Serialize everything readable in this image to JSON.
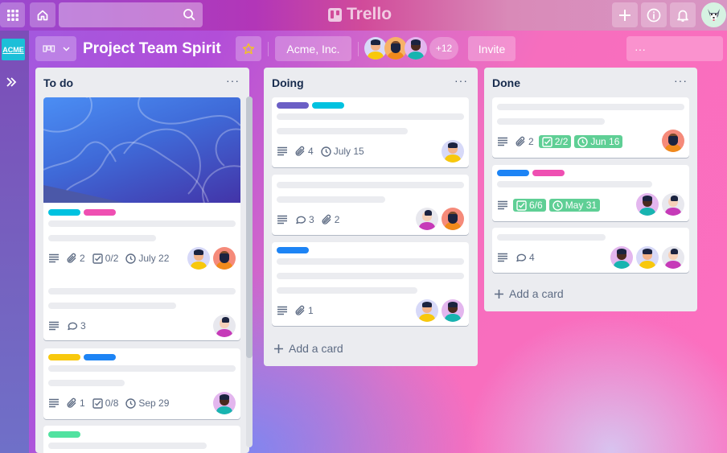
{
  "topbar": {
    "apps_icon": "grid-icon",
    "home_icon": "home-icon",
    "search_placeholder": "",
    "logo_text": "Trello",
    "create_icon": "plus-icon",
    "info_icon": "info-icon",
    "notifications_icon": "bell-icon",
    "profile_avatar": "husky-avatar"
  },
  "sidebar": {
    "workspace_logo": "ACME",
    "expand_icon": "double-chevron-right-icon"
  },
  "board_header": {
    "title": "Project Team Spirit",
    "starred": true,
    "workspace": "Acme, Inc.",
    "member_extra_count": "+12",
    "invite_label": "Invite",
    "more_label": "···"
  },
  "colors": {
    "green_badge": "#5fcf95",
    "cyan": "#00c2e0",
    "pink": "#ef4fb2",
    "purple": "#6b5fc5",
    "blue": "#1d84f5",
    "yellow": "#f8c80c",
    "green": "#51e2a0"
  },
  "lists": [
    {
      "title": "To do",
      "menu": "···",
      "cards": [
        {
          "cover": true,
          "labels": [
            "cyan",
            "pink"
          ],
          "attachments": "2",
          "checklist": "0/2",
          "due": "July 22",
          "members": [
            "yellow",
            "orange"
          ]
        },
        {
          "labels": [],
          "comments": "3",
          "members": [
            "magenta"
          ]
        },
        {
          "labels": [
            "yellow",
            "blue"
          ],
          "attachments": "1",
          "checklist": "0/8",
          "due": "Sep 29",
          "members": [
            "teal"
          ]
        },
        {
          "labels": [
            "green"
          ]
        }
      ]
    },
    {
      "title": "Doing",
      "menu": "···",
      "add_card": "Add a card",
      "cards": [
        {
          "labels": [
            "purple",
            "cyan"
          ],
          "attachments": "4",
          "due": "July 15",
          "members": [
            "yellow"
          ]
        },
        {
          "labels": [],
          "comments": "3",
          "attachments": "2",
          "members": [
            "magenta",
            "orange"
          ]
        },
        {
          "labels": [
            "blue"
          ],
          "attachments": "1",
          "members": [
            "yellow",
            "teal"
          ]
        }
      ]
    },
    {
      "title": "Done",
      "menu": "···",
      "add_card": "Add a card",
      "cards": [
        {
          "labels": [],
          "attachments": "2",
          "checklist": "2/2",
          "due": "Jun 16",
          "members": [
            "orange"
          ]
        },
        {
          "labels": [
            "blue",
            "pink"
          ],
          "checklist": "6/6",
          "due": "May 31",
          "members": [
            "teal",
            "magenta"
          ]
        },
        {
          "labels": [],
          "comments": "4",
          "members": [
            "teal",
            "yellow",
            "magenta"
          ]
        }
      ]
    }
  ]
}
